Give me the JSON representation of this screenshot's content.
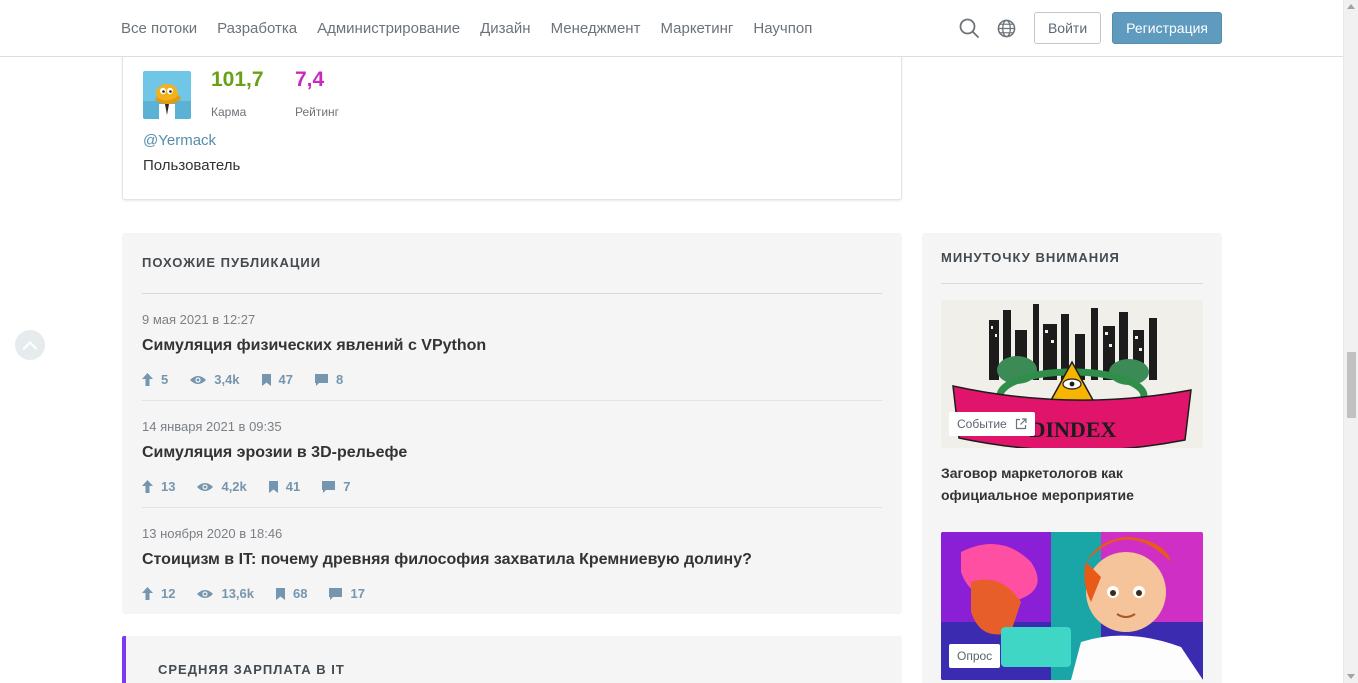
{
  "nav": {
    "items": [
      "Все потоки",
      "Разработка",
      "Администрирование",
      "Дизайн",
      "Менеджмент",
      "Маркетинг",
      "Научпоп"
    ],
    "login_label": "Войти",
    "register_label": "Регистрация"
  },
  "author": {
    "karma_value": "101,7",
    "karma_label": "Карма",
    "rating_value": "7,4",
    "rating_label": "Рейтинг",
    "username": "@Yermack",
    "role": "Пользователь"
  },
  "similar": {
    "title": "ПОХОЖИЕ ПУБЛИКАЦИИ",
    "items": [
      {
        "date": "9 мая 2021 в 12:27",
        "title": "Симуляция физических явлений с VPython",
        "votes": "5",
        "views": "3,4k",
        "bookmarks": "47",
        "comments": "8"
      },
      {
        "date": "14 января 2021 в 09:35",
        "title": "Симуляция эрозии в 3D-рельефе",
        "votes": "13",
        "views": "4,2k",
        "bookmarks": "41",
        "comments": "7"
      },
      {
        "date": "13 ноября 2020 в 18:46",
        "title": "Стоицизм в IT: почему древняя философия захватила Кремниевую долину?",
        "votes": "12",
        "views": "13,6k",
        "bookmarks": "68",
        "comments": "17"
      }
    ]
  },
  "salary": {
    "title": "СРЕДНЯЯ ЗАРПЛАТА В IT"
  },
  "sidebar": {
    "title": "МИНУТОЧКУ ВНИМАНИЯ",
    "promo1": {
      "badge": "Событие",
      "banner_text": "DINDEX",
      "title": "Заговор маркетологов как официальное мероприятие"
    },
    "promo2": {
      "badge": "Опрос"
    }
  },
  "colors": {
    "accent": "#548eaa",
    "karma": "#6aa017",
    "rating": "#c72bbd",
    "salary_border": "#7b3af2"
  }
}
